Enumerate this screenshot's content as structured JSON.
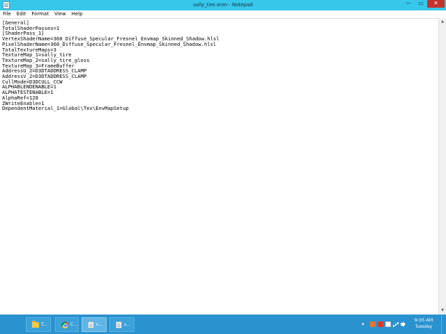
{
  "window": {
    "title": "sally_tire.xnm - Notepad",
    "minimize_glyph": "—",
    "maximize_glyph": "▭",
    "close_glyph": "✕"
  },
  "menu": {
    "items": [
      {
        "label": "File"
      },
      {
        "label": "Edit"
      },
      {
        "label": "Format"
      },
      {
        "label": "View"
      },
      {
        "label": "Help"
      }
    ]
  },
  "editor": {
    "content": "[General]\nTotalShaderPasses=1\n[ShaderPass_1]\nVertexShaderName=360_Diffuse_Specular_Fresnel_Envmap_Skinned_Shadow.hlsl\nPixelShaderName=360_Diffuse_Specular_Fresnel_Envmap_Skinned_Shadow.hlsl\nTotalTextureMaps=3\nTextureMap_1=sally_tire\nTextureMap_2=sally_tire_gloss\nTextureMap_3=FrameBuffer\nAddressU_2=D3DTADDRESS_CLAMP\nAddressV_2=D3DTADDRESS_CLAMP\nCullMode=D3DCULL_CCW\nALPHABLENDENABLE=1\nALPHATESTENABLE=1\nAlphaRef=128\nZWriteEnable=1\nDependentMaterial_1=Global\\Tex\\EnvMapSetup"
  },
  "scrollbar": {
    "up_glyph": "▲",
    "down_glyph": "▼"
  },
  "taskbar": {
    "buttons": [
      {
        "label": "T...",
        "icon": "folder-icon"
      },
      {
        "label": "C...",
        "icon": "chrome-icon"
      },
      {
        "label": "s...",
        "icon": "notepad-icon"
      },
      {
        "label": "s...",
        "icon": "notepad-icon"
      }
    ],
    "tray_arrow": "▴",
    "clock": {
      "time": "9:05 AM",
      "day": "Tuesday"
    }
  },
  "colors": {
    "titlebar": "#37c7ea",
    "taskbar": "#2b92d0",
    "close_button": "#c7312c"
  }
}
